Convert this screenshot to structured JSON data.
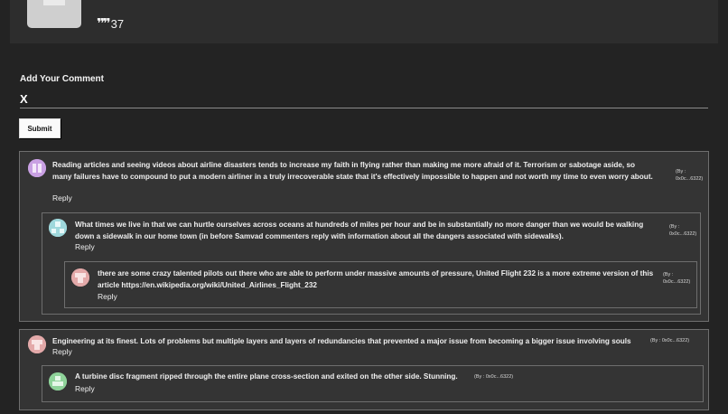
{
  "top": {
    "count": "37",
    "quote_icon": "quote-icon"
  },
  "form": {
    "label": "Add Your Comment",
    "input_value": "X",
    "submit_label": "Submit"
  },
  "comments": [
    {
      "text": "Reading articles and seeing videos about airline disasters tends to increase my faith in flying rather than making me more afraid of it. Terrorism or sabotage aside, so many failures have to compound to put a modern airliner in a truly irrecoverable state that it's effectively impossible to happen and not worth my time to even worry about.",
      "by": "(By : 0x0c...6322)",
      "reply": "Reply",
      "avatar_color": "#c9a0e3",
      "replies": [
        {
          "text": "What times we live in that we can hurtle ourselves across oceans at hundreds of miles per hour and be in substantially no more danger than we would be walking down a sidewalk in our home town (in before Samvad commenters reply with information about all the dangers associated with sidewalks).",
          "by": "(By : 0x0c...6322)",
          "reply": "Reply",
          "avatar_color": "#9fd8dc",
          "replies": [
            {
              "text": "there are some crazy talented pilots out there who are able to perform under massive amounts of pressure, United Flight 232 is a more extreme version of this article https://en.wikipedia.org/wiki/United_Airlines_Flight_232",
              "by": "(By : 0x0c...6322)",
              "reply": "Reply",
              "avatar_color": "#e3a9a9"
            }
          ]
        }
      ]
    },
    {
      "text": "Engineering at its finest. Lots of problems but multiple layers and layers of redundancies that prevented a major issue from becoming a bigger issue involving souls",
      "by": "(By : 0x0c...6322)",
      "reply": "Reply",
      "avatar_color": "#e3a9a9",
      "replies": [
        {
          "text": "A turbine disc fragment ripped through the entire plane cross-section and exited on the other side. Stunning.",
          "by": "(By : 0x0c...6322)",
          "reply": "Reply",
          "avatar_color": "#8fd39a"
        }
      ]
    }
  ]
}
